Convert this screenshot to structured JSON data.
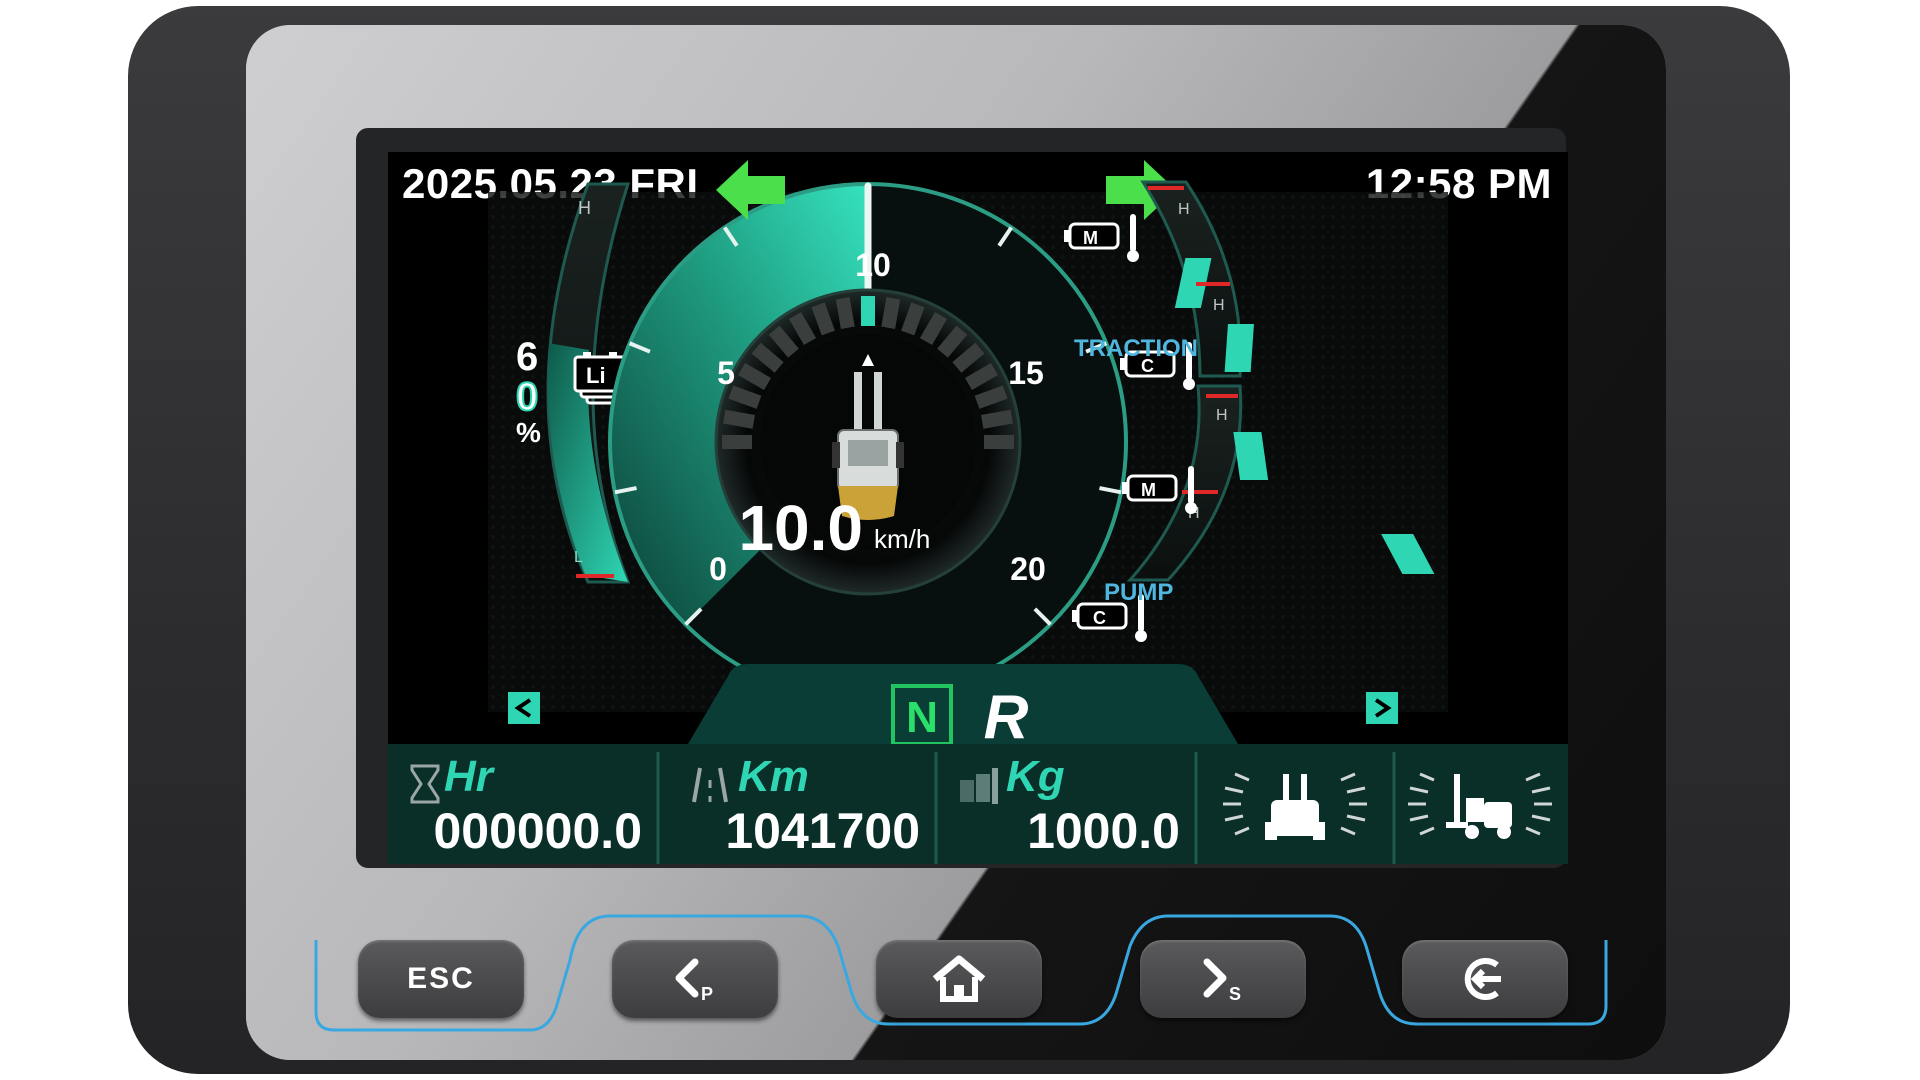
{
  "header": {
    "date": "2025.05.23 FRI",
    "time": "12:58 PM"
  },
  "battery": {
    "percent_text": [
      "6",
      "0",
      "%"
    ],
    "percent": 60,
    "type_label": "Li",
    "high_label": "H",
    "low_label": "L"
  },
  "speedometer": {
    "ticks": [
      "0",
      "5",
      "10",
      "15",
      "20"
    ],
    "speed_value": "10.0",
    "speed_unit": "km/h",
    "speed": 10.0,
    "max": 20
  },
  "gear": {
    "neutral": "N",
    "reverse": "R"
  },
  "temperatures": {
    "traction_label": "TRACTION",
    "pump_label": "PUMP",
    "motor_label": "M",
    "controller_label": "C",
    "high_label": "H",
    "cold_label": "C"
  },
  "stats": {
    "hours": {
      "label": "Hr",
      "value": "000000.0"
    },
    "distance": {
      "label": "Km",
      "value": "1041700"
    },
    "load": {
      "label": "Kg",
      "value": "1000.0"
    }
  },
  "colors": {
    "accent": "#2fd6b4",
    "green_arrow": "#4be04b",
    "bezel": "#bdbdbf",
    "screen": "#000000",
    "button_glow": "#3aa8e0"
  },
  "buttons": {
    "esc": "ESC",
    "prev_sub": "P",
    "next_sub": "S"
  },
  "icons": [
    "arrow-left-icon",
    "arrow-right-icon",
    "battery-icon",
    "forklift-icon",
    "hourglass-icon",
    "odometer-icon",
    "weight-icon",
    "forklift-front-icon",
    "forklift-side-icon",
    "home-icon",
    "enter-icon",
    "motor-temp-icon",
    "controller-temp-icon"
  ]
}
